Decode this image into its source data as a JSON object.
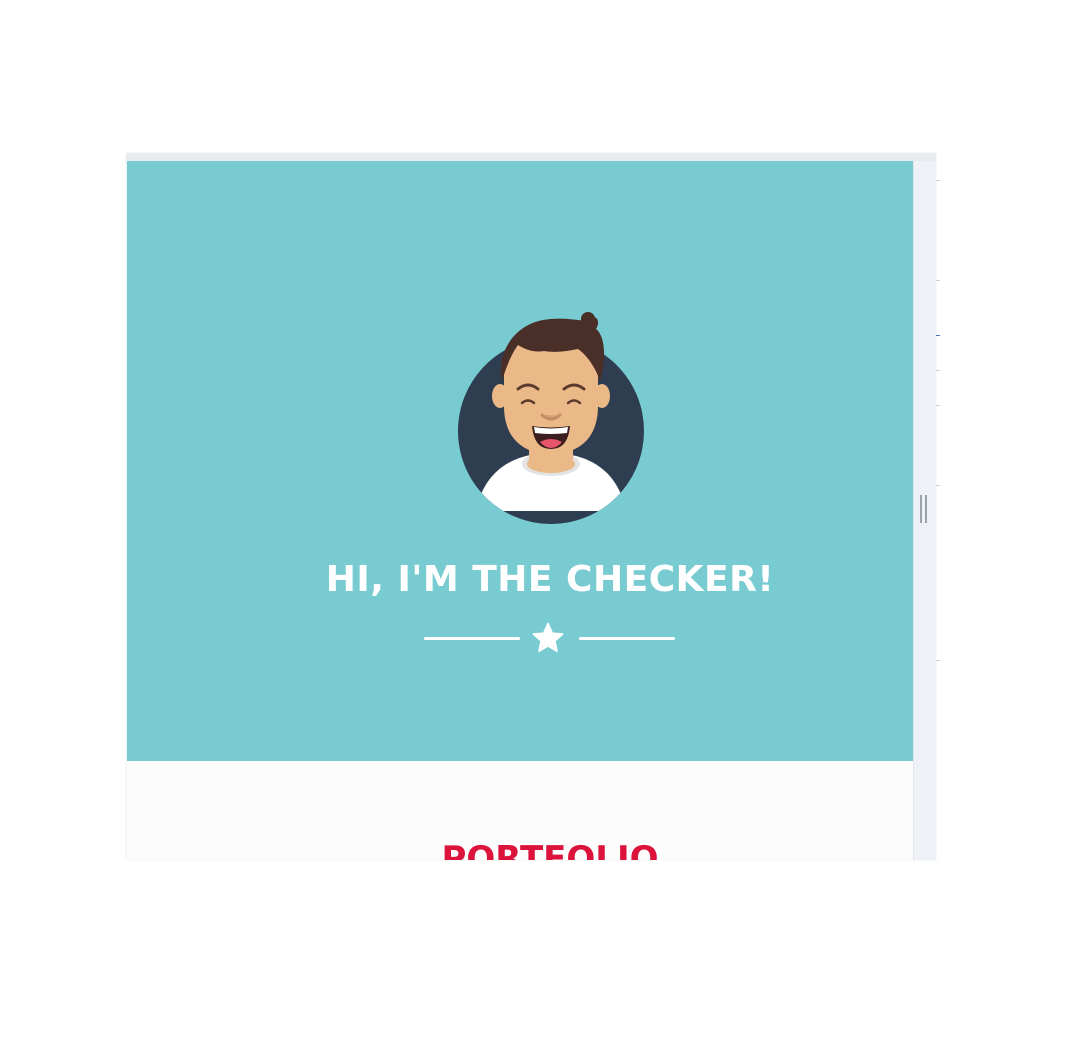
{
  "hero": {
    "title": "HI, I'M THE CHECKER!",
    "background_color": "#78ccd1",
    "avatar_icon": "smiling-person-avatar-icon",
    "divider_icon": "star-icon"
  },
  "section": {
    "title": "PORTFOLIO",
    "title_color": "#dc143c"
  }
}
